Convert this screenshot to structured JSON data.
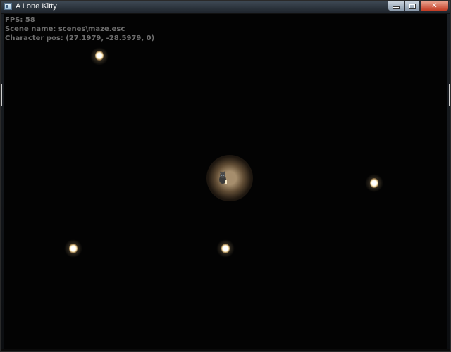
{
  "window": {
    "title": "A Lone Kitty",
    "controls": {
      "minimize_icon": "minimize-icon",
      "maximize_icon": "maximize-icon",
      "close_icon": "close-icon",
      "close_glyph": "✕"
    }
  },
  "hud": {
    "fps": "FPS: 58",
    "scene_name": "Scene name: scenes\\maze.esc",
    "character_pos": "Character pos: (27.1979, -28.5979, 0)"
  },
  "colors": {
    "background": "#030303",
    "hud_text": "#6f6f6f",
    "light": "#ffeec0",
    "titlebar": "#2b333c",
    "close_button": "#c43c24"
  },
  "scene": {
    "lights": [
      {
        "name": "light-1"
      },
      {
        "name": "light-2"
      },
      {
        "name": "light-3"
      },
      {
        "name": "light-4"
      }
    ],
    "character": {
      "name": "kitty-character-icon"
    }
  }
}
